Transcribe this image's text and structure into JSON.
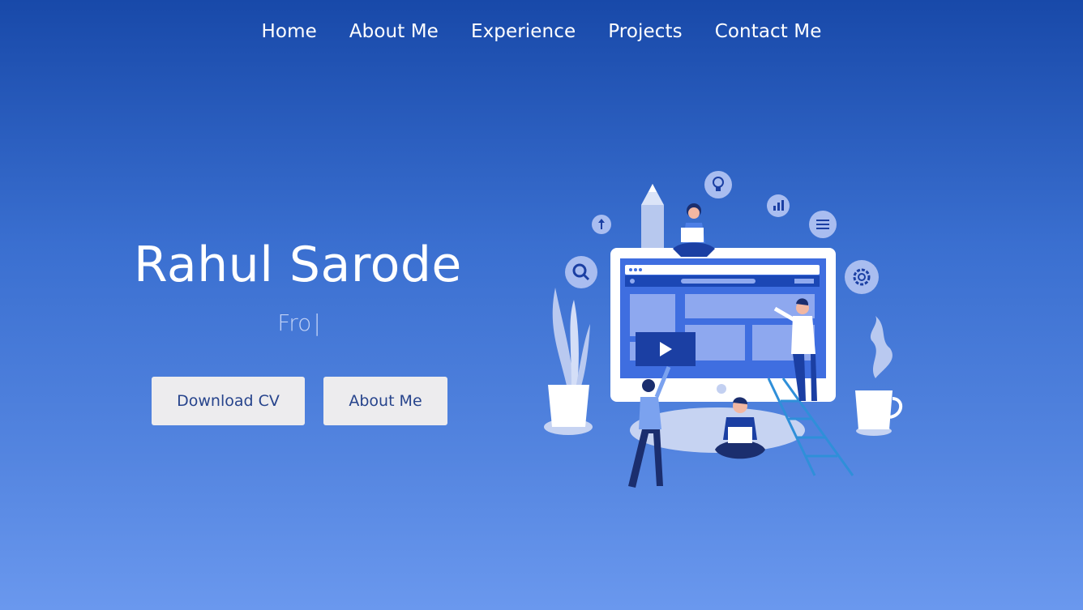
{
  "nav": {
    "items": [
      {
        "label": "Home"
      },
      {
        "label": "About Me"
      },
      {
        "label": "Experience"
      },
      {
        "label": "Projects"
      },
      {
        "label": "Contact Me"
      }
    ]
  },
  "hero": {
    "name": "Rahul Sarode",
    "typed_text": "Fro",
    "caret": "|",
    "buttons": {
      "download_cv": "Download CV",
      "about_me": "About Me"
    }
  },
  "illustration": {
    "icons": [
      "search-icon",
      "upload-icon",
      "lightbulb-icon",
      "bar-chart-icon",
      "menu-lines-icon",
      "gear-icon",
      "play-icon"
    ]
  },
  "colors": {
    "background_top": "#1849a9",
    "background_bottom": "#6a98ee",
    "button_bg": "#edecee",
    "button_text": "#27448c",
    "typed_text": "#c2d2f6"
  }
}
